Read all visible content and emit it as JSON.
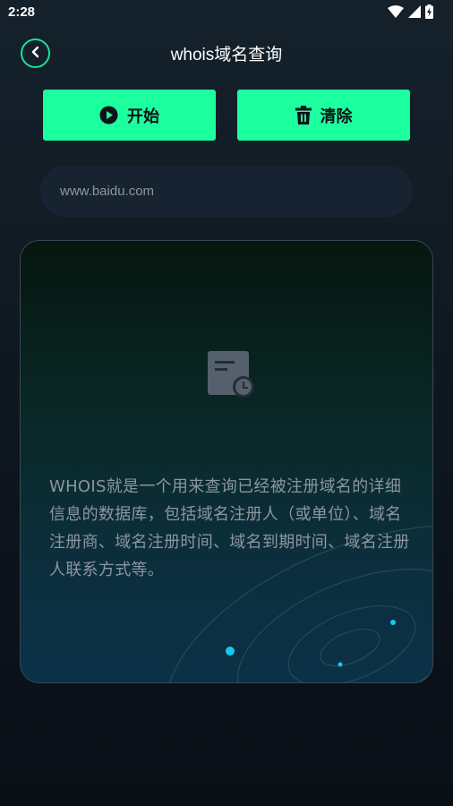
{
  "status_bar": {
    "time": "2:28"
  },
  "header": {
    "title": "whois域名查询"
  },
  "actions": {
    "start_label": "开始",
    "clear_label": "清除"
  },
  "search": {
    "value": "www.baidu.com"
  },
  "result": {
    "description": "WHOIS就是一个用来查询已经被注册域名的详细信息的数据库，包括域名注册人（或单位）、域名注册商、域名注册时间、域名到期时间、域名注册人联系方式等。"
  },
  "colors": {
    "accent": "#1cff9e",
    "back_border": "#18e39a",
    "input_bg": "#172330",
    "orbit_dot": "#19c6f2"
  },
  "icons": [
    "wifi-icon",
    "signal-icon",
    "battery-charging-icon",
    "back-chevron-icon",
    "play-circle-icon",
    "trash-icon",
    "document-clock-icon"
  ]
}
